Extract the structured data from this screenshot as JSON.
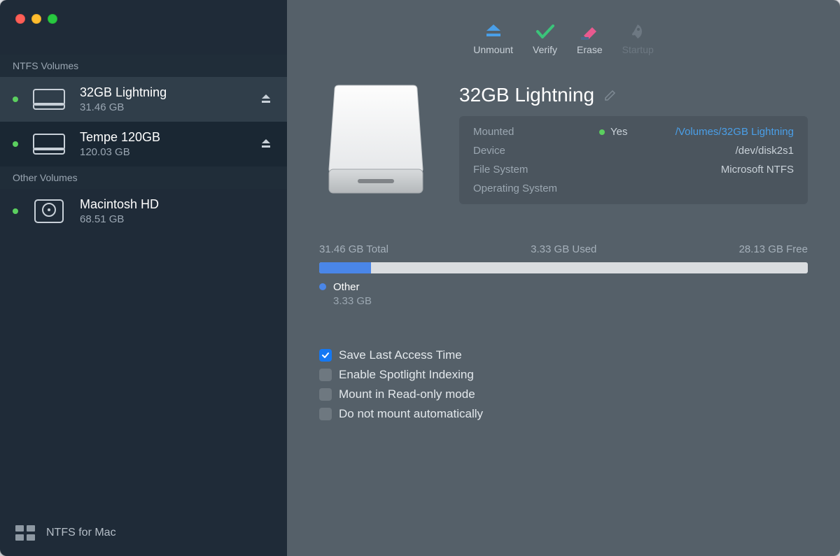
{
  "sidebar": {
    "sections": [
      {
        "title": "NTFS Volumes"
      },
      {
        "title": "Other Volumes"
      }
    ],
    "ntfs": [
      {
        "name": "32GB Lightning",
        "size": "31.46 GB",
        "selected": true
      },
      {
        "name": "Tempe 120GB",
        "size": "120.03 GB",
        "selected": false
      }
    ],
    "other": [
      {
        "name": "Macintosh HD",
        "size": "68.51 GB"
      }
    ],
    "footer": "NTFS for Mac"
  },
  "toolbar": {
    "unmount": "Unmount",
    "verify": "Verify",
    "erase": "Erase",
    "startup": "Startup"
  },
  "detail": {
    "name": "32GB Lightning",
    "info": {
      "mounted_label": "Mounted",
      "mounted_value": "Yes",
      "mounted_path": "/Volumes/32GB Lightning",
      "device_label": "Device",
      "device_value": "/dev/disk2s1",
      "fs_label": "File System",
      "fs_value": "Microsoft NTFS",
      "os_label": "Operating System",
      "os_value": ""
    },
    "usage": {
      "total": "31.46 GB Total",
      "used": "3.33 GB Used",
      "free": "28.13 GB Free",
      "fill_percent": 10.6,
      "legend_name": "Other",
      "legend_size": "3.33 GB"
    },
    "options": {
      "save_access_time": {
        "label": "Save Last Access Time",
        "checked": true
      },
      "spotlight": {
        "label": "Enable Spotlight Indexing",
        "checked": false
      },
      "readonly": {
        "label": "Mount in Read-only mode",
        "checked": false
      },
      "noauto": {
        "label": "Do not mount automatically",
        "checked": false
      }
    }
  }
}
